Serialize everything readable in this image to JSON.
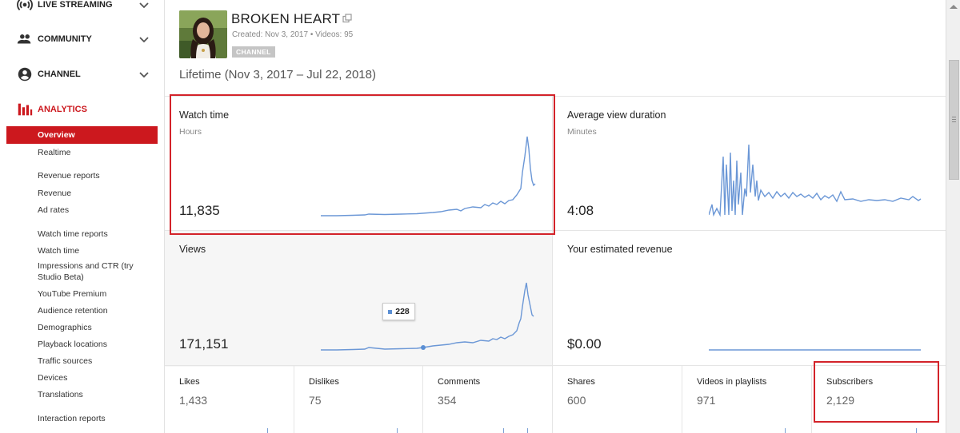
{
  "sidebar": {
    "sections": [
      {
        "label": "LIVE STREAMING",
        "icon": "live-streaming-icon"
      },
      {
        "label": "COMMUNITY",
        "icon": "community-icon"
      },
      {
        "label": "CHANNEL",
        "icon": "channel-icon"
      },
      {
        "label": "ANALYTICS",
        "icon": "analytics-icon"
      }
    ],
    "items": [
      "Overview",
      "Realtime",
      "Revenue reports",
      "Revenue",
      "Ad rates",
      "Watch time reports",
      "Watch time",
      "Impressions and CTR (try",
      "Studio Beta)",
      "YouTube Premium",
      "Audience retention",
      "Demographics",
      "Playback locations",
      "Traffic sources",
      "Devices",
      "Translations",
      "Interaction reports"
    ]
  },
  "channel": {
    "title": "BROKEN HEART",
    "meta": "Created: Nov 3, 2017  •  Videos: 95",
    "badge": "CHANNEL",
    "lifetime": "Lifetime (Nov 3, 2017 – Jul 22, 2018)"
  },
  "cards": {
    "watch_time": {
      "title": "Watch time",
      "unit": "Hours",
      "value": "11,835"
    },
    "avg_view": {
      "title": "Average view duration",
      "unit": "Minutes",
      "value": "4:08"
    },
    "views": {
      "title": "Views",
      "value": "171,151",
      "tooltip": "228"
    },
    "revenue": {
      "title": "Your estimated revenue",
      "value": "$0.00"
    }
  },
  "metrics": [
    {
      "title": "Likes",
      "value": "1,433"
    },
    {
      "title": "Dislikes",
      "value": "75"
    },
    {
      "title": "Comments",
      "value": "354"
    },
    {
      "title": "Shares",
      "value": "600"
    },
    {
      "title": "Videos in playlists",
      "value": "971"
    },
    {
      "title": "Subscribers",
      "value": "2,129"
    }
  ],
  "colors": {
    "accent": "#cc181e",
    "sparkline": "#6b97d6",
    "highlight": "#d3232a"
  }
}
